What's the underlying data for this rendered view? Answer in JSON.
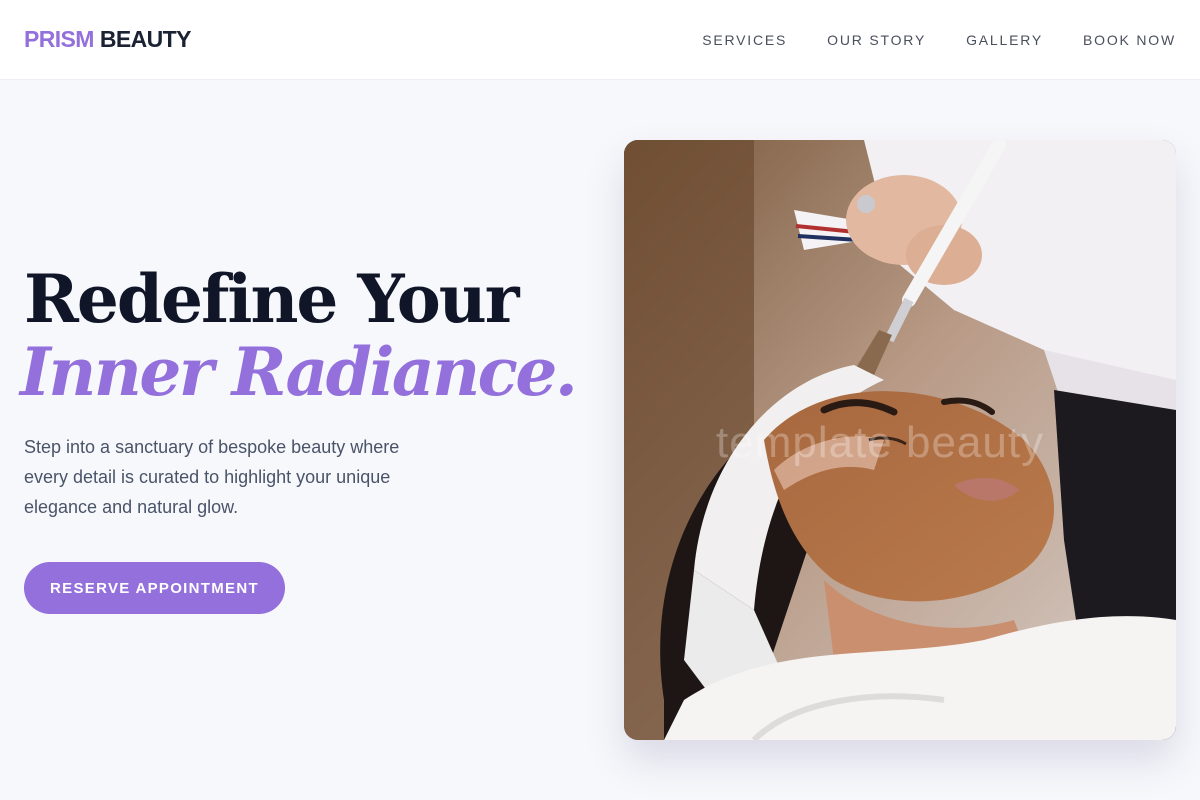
{
  "brand": {
    "accent": "PRISM",
    "rest": "BEAUTY",
    "accent_color": "#9370db"
  },
  "nav": {
    "items": [
      {
        "label": "SERVICES"
      },
      {
        "label": "OUR STORY"
      },
      {
        "label": "GALLERY"
      },
      {
        "label": "BOOK NOW"
      }
    ]
  },
  "hero": {
    "title_line1": "Redefine Your",
    "title_line2": "Inner Radiance.",
    "description": "Step into a sanctuary of bespoke beauty where every detail is curated to highlight your unique elegance and natural glow.",
    "cta_label": "RESERVE APPOINTMENT"
  },
  "image": {
    "watermark": "template beauty"
  }
}
